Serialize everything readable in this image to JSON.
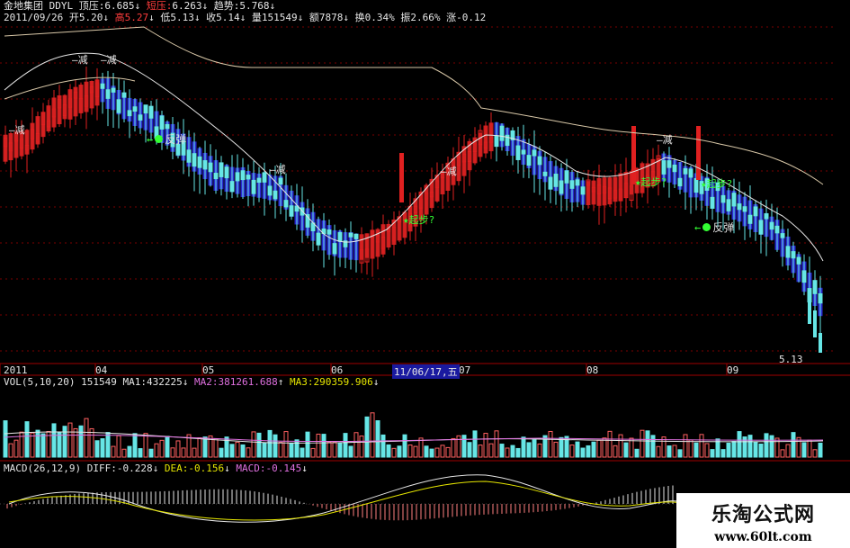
{
  "header": {
    "stock_name": "金地集团",
    "indicator_name": "DDYL",
    "top_res_label": "顶压:",
    "top_res_value": "6.685",
    "short_res_label": "短压:",
    "short_res_value": "6.263",
    "trend_label": "趋势:",
    "trend_value": "5.768",
    "date": "2011/09/26",
    "open_label": "开",
    "open_value": "5.20",
    "high_label": "高",
    "high_value": "5.27",
    "low_label": "低",
    "low_value": "5.13",
    "close_label": "收",
    "close_value": "5.14",
    "volume_label": "量",
    "volume_value": "151549",
    "amount_label": "额",
    "amount_value": "7878",
    "turnover_label": "换",
    "turnover_value": "0.34%",
    "amplitude_label": "振",
    "amplitude_value": "2.66%",
    "change_label": "涨",
    "change_value": "-0.12",
    "arrow_down": "↓",
    "arrow_up": "↑"
  },
  "annotations": {
    "sell": "减",
    "rebound": "反弹",
    "start": "起步?",
    "low_price": "5.13"
  },
  "x_axis": {
    "ticks": [
      "2011",
      "04",
      "05",
      "06",
      "07",
      "08",
      "09"
    ],
    "cursor_label": "11/06/17,五"
  },
  "volume_panel": {
    "title": "VOL(5,10,20)",
    "vol_value": "151549",
    "ma1_label": "MA1:",
    "ma1_value": "432225",
    "ma2_label": "MA2:",
    "ma2_value": "381261.688",
    "ma3_label": "MA3:",
    "ma3_value": "290359.906"
  },
  "macd_panel": {
    "title": "MACD(26,12,9)",
    "diff_label": "DIFF:",
    "diff_value": "-0.228",
    "dea_label": "DEA:",
    "dea_value": "-0.156",
    "macd_label": "MACD:",
    "macd_value": "-0.145"
  },
  "watermark": {
    "title": "乐淘公式网",
    "url": "www.60lt.com"
  },
  "colors": {
    "background": "#000000",
    "up_candle": "#e02020",
    "down_candle_thin": "#66e6e6",
    "ribbon_up": "#cc1f1f",
    "ribbon_down": "#2a2ad0",
    "header_red": "#ff3c3c",
    "header_white": "#e6e6e6",
    "header_yellow": "#e6e600",
    "header_purple": "#e070e0",
    "grid_red": "#7a0000",
    "annotation_green": "#33ff33"
  },
  "chart_data": {
    "type": "candlestick",
    "title": "金地集团 DDYL",
    "period": "2011-01 to 2011-09",
    "x_ticks": [
      "2011",
      "04",
      "05",
      "06",
      "07",
      "08",
      "09"
    ],
    "price_overlay_lines": [
      "顶压",
      "短压",
      "趋势"
    ],
    "last_bar": {
      "date": "2011/09/26",
      "open": 5.2,
      "high": 5.27,
      "low": 5.13,
      "close": 5.14,
      "volume": 151549
    },
    "min_marked_price": 5.13,
    "volume_indicators": {
      "VOL": 151549,
      "MA1": 432225,
      "MA2": 381261.688,
      "MA3": 290359.906
    },
    "macd_indicators": {
      "DIFF": -0.228,
      "DEA": -0.156,
      "MACD": -0.145
    },
    "grid": true
  }
}
